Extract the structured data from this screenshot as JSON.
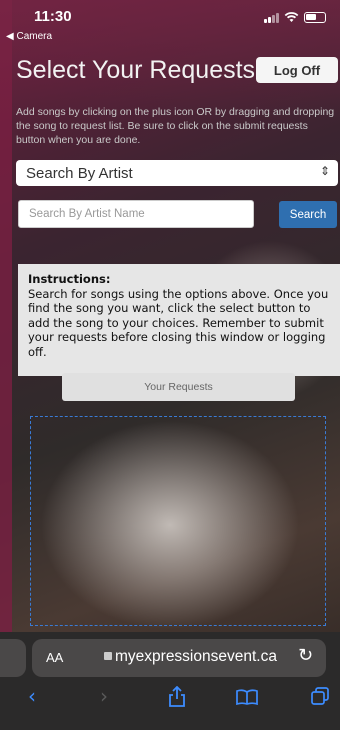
{
  "status": {
    "time": "11:30",
    "back_label": "◀ Camera"
  },
  "header": {
    "title": "Select Your Requests",
    "logoff_label": "Log Off"
  },
  "intro": {
    "text": "Add songs by clicking on the plus icon OR by dragging and dropping the song to request list. Be sure to click on the submit requests button when you are done."
  },
  "search": {
    "mode_selected": "Search By Artist",
    "placeholder": "Search By Artist Name",
    "value": "",
    "button_label": "Search"
  },
  "instructions": {
    "heading": "Instructions:",
    "body": "Search for songs using the options above. Once you find the song you want, click the select button to add the song to your choices. Remember to submit your requests before closing this window or logging off."
  },
  "requests": {
    "button_label": "Your Requests"
  },
  "browser": {
    "text_size_label": "AA",
    "url": "myexpressionsevent.ca",
    "accent_color": "#3d8cff"
  }
}
